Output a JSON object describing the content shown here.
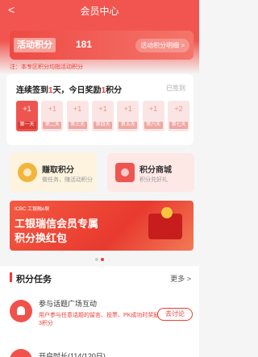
{
  "nav": {
    "back": "<",
    "title": "会员中心"
  },
  "points": {
    "label": "活动积分",
    "value": "181",
    "detail": "活动积分明细 >"
  },
  "notice": "注：本专区积分均指活动积分",
  "signin": {
    "title_prefix": "连续签到",
    "days_count": "1",
    "title_mid": "天，今日奖励",
    "reward": "1",
    "title_suffix": "积分",
    "status": "已签到",
    "days": [
      {
        "plus": "+1",
        "label": "第一天",
        "active": true
      },
      {
        "plus": "+1",
        "label": "第二天",
        "active": false
      },
      {
        "plus": "+1",
        "label": "第三天",
        "active": false
      },
      {
        "plus": "+1",
        "label": "第四天",
        "active": false
      },
      {
        "plus": "+1",
        "label": "第五天",
        "active": false
      },
      {
        "plus": "+1",
        "label": "第六天",
        "active": false
      },
      {
        "plus": "+2",
        "label": "第七天",
        "active": false
      }
    ]
  },
  "features": {
    "earn": {
      "title": "赚取积分",
      "subtitle": "做任务，赚活动积分",
      "icon": "coins-icon"
    },
    "mall": {
      "title": "积分商城",
      "subtitle": "积分兑好礼",
      "icon": "wallet-icon"
    }
  },
  "banner": {
    "brand": "ICBC 工银融e联",
    "line1": "工银瑞信会员专属",
    "line2": "积分换红包"
  },
  "tasks": {
    "title": "积分任务",
    "more": "更多 >",
    "items": [
      {
        "name": "参与话题广场互动",
        "desc": "用户参与任意话题的留言、投票、PK成功时奖励3积分",
        "button": "去讨论",
        "icon": "bell-icon"
      },
      {
        "name": "开启时长(114/120日)"
      }
    ]
  },
  "colors": {
    "accent": "#f23a33",
    "header": "#f2554f"
  }
}
